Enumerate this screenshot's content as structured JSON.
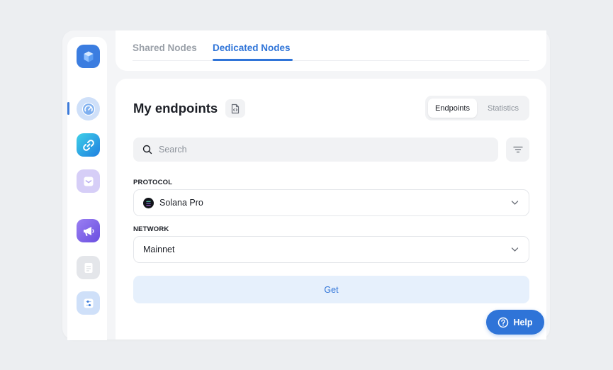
{
  "tabs": {
    "shared": "Shared Nodes",
    "dedicated": "Dedicated Nodes",
    "active": "Dedicated Nodes"
  },
  "sidebar": {
    "items": [
      {
        "icon": "cube-logo-icon"
      },
      {
        "icon": "speedometer-icon",
        "active": true
      },
      {
        "icon": "link-icon"
      },
      {
        "icon": "inbox-icon"
      },
      {
        "icon": "megaphone-icon"
      },
      {
        "icon": "document-icon"
      },
      {
        "icon": "sliders-icon"
      }
    ]
  },
  "main": {
    "title": "My endpoints",
    "view_toggle": {
      "endpoints": "Endpoints",
      "statistics": "Statistics",
      "active": "Endpoints"
    },
    "search": {
      "placeholder": "Search",
      "value": ""
    },
    "protocol": {
      "label": "PROTOCOL",
      "value": "Solana Pro",
      "icon": "solana-icon"
    },
    "network": {
      "label": "NETWORK",
      "value": "Mainnet"
    },
    "get_label": "Get"
  },
  "help": {
    "label": "Help"
  },
  "colors": {
    "accent": "#2f74d8",
    "background": "#eceef1",
    "get_button_bg": "#e6f0fc"
  }
}
